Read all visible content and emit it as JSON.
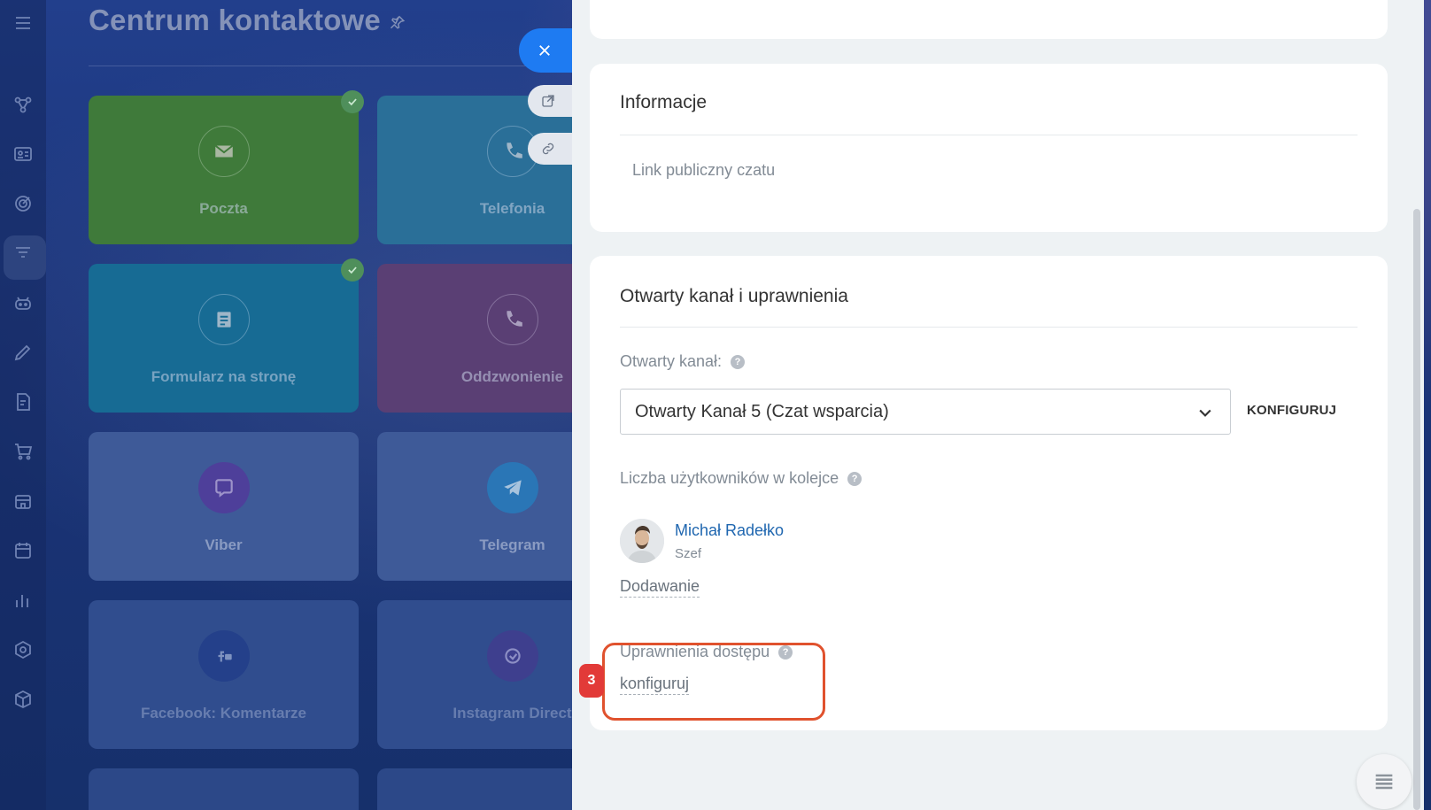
{
  "page": {
    "title": "Centrum kontaktowe"
  },
  "tiles": [
    {
      "label": "Poczta",
      "icon": "mail-icon",
      "connected": true
    },
    {
      "label": "Telefonia",
      "icon": "phone-icon",
      "connected": false
    },
    {
      "label": "Formularz na stronę",
      "icon": "form-icon",
      "connected": true
    },
    {
      "label": "Oddzwonienie",
      "icon": "callback-icon",
      "connected": false
    },
    {
      "label": "Viber",
      "icon": "viber-icon",
      "connected": false
    },
    {
      "label": "Telegram",
      "icon": "telegram-icon",
      "connected": false
    },
    {
      "label": "Facebook: Komentarze",
      "icon": "facebook-icon",
      "connected": false
    },
    {
      "label": "Instagram Direct",
      "icon": "instagram-icon",
      "connected": false
    }
  ],
  "slider": {
    "info": {
      "title": "Informacje",
      "public_link_label": "Link publiczny czatu"
    },
    "perm": {
      "title": "Otwarty kanał i uprawnienia",
      "channel_label": "Otwarty kanał:",
      "channel_value": "Otwarty Kanał 5 (Czat wsparcia)",
      "configure_button": "KONFIGURUJ",
      "queue_label": "Liczba użytkowników w kolejce",
      "user": {
        "name": "Michał Radełko",
        "role": "Szef"
      },
      "add_link": "Dodawanie",
      "access_label": "Uprawnienia dostępu",
      "access_link": "konfiguruj"
    },
    "step_number": "3"
  },
  "colors": {
    "accent": "#1e7bf2",
    "highlight": "#e0522e",
    "badge": "#e23a38",
    "link": "#2067b0"
  }
}
